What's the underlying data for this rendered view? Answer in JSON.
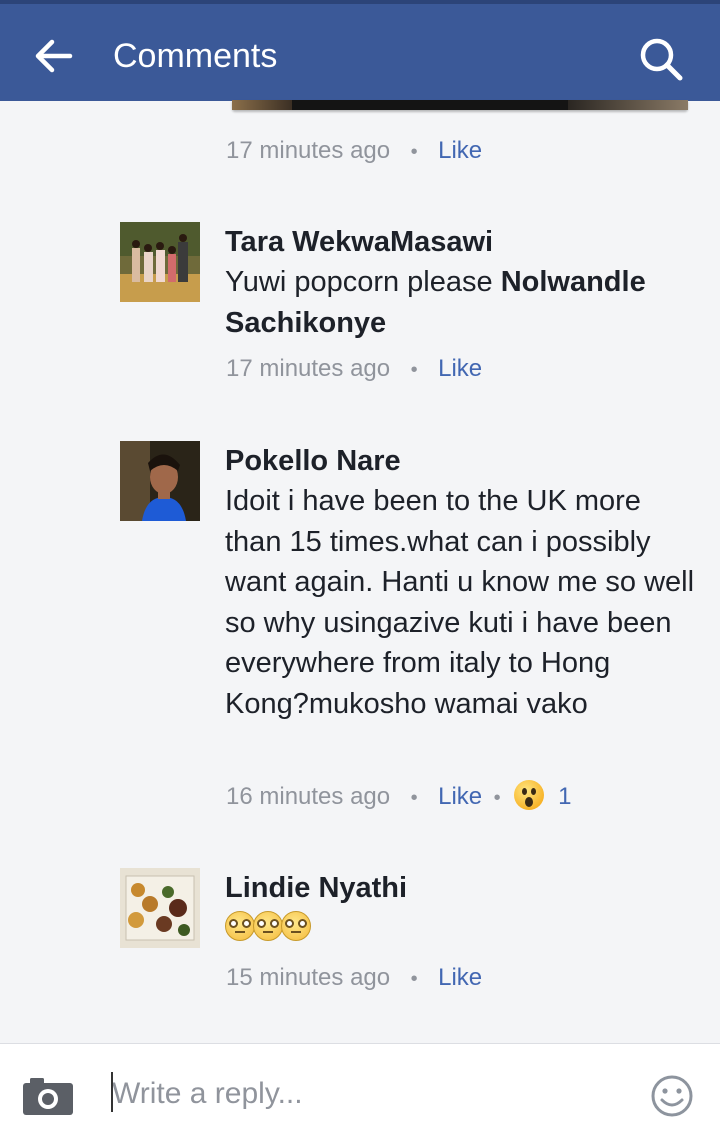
{
  "header": {
    "title": "Comments",
    "back_icon": "arrow-left-icon",
    "search_icon": "search-icon",
    "background": "#3b5998"
  },
  "top_meta": {
    "timestamp": "17 minutes ago",
    "like_label": "Like"
  },
  "comments": [
    {
      "author": "Tara WekwaMasawi",
      "text": "Yuwi popcorn please ",
      "mention": "Nolwandle Sachikonye",
      "timestamp": "17 minutes ago",
      "like_label": "Like"
    },
    {
      "author": "Pokello Nare",
      "text": "Idoit i have been to the UK more than 15 times.what can i possibly want again. Hanti u know me so well so why usingazive kuti i have been everywhere from italy to Hong Kong?mukosho wamai vako",
      "timestamp": "16 minutes ago",
      "like_label": "Like",
      "reaction_icon": "wow-reaction-icon",
      "reaction_count": "1"
    },
    {
      "author": "Lindie Nyathi",
      "emoji_icon": "flushed-face-icon",
      "emoji_count": 3,
      "timestamp": "15 minutes ago",
      "like_label": "Like"
    }
  ],
  "composer": {
    "placeholder": "Write a reply...",
    "camera_icon": "camera-icon",
    "emoji_icon": "smiley-icon"
  },
  "colors": {
    "link": "#4267b2",
    "meta_text": "#90949c",
    "body_text": "#1d2129",
    "page_bg": "#f4f5f7"
  }
}
